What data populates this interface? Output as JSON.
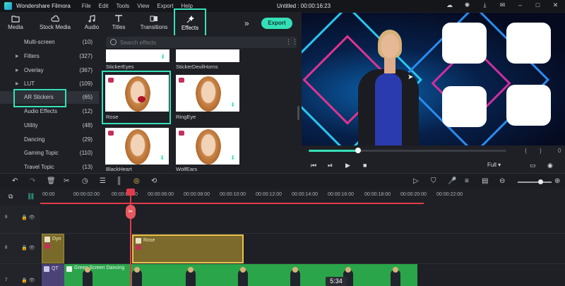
{
  "app": {
    "name": "Wondershare Filmora",
    "doc_title": "Untitled : 00:00:16:23"
  },
  "menu": [
    "File",
    "Edit",
    "Tools",
    "View",
    "Export",
    "Help"
  ],
  "tabs": [
    {
      "label": "Media",
      "icon": "folder-icon"
    },
    {
      "label": "Stock Media",
      "icon": "cloud-icon"
    },
    {
      "label": "Audio",
      "icon": "music-note-icon"
    },
    {
      "label": "Titles",
      "icon": "text-t-icon"
    },
    {
      "label": "Transitions",
      "icon": "transition-icon"
    },
    {
      "label": "Effects",
      "icon": "magic-wand-icon"
    }
  ],
  "export_label": "Export",
  "categories": [
    {
      "name": "Multi-screen",
      "count": "(10)"
    },
    {
      "name": "Filters",
      "count": "(327)"
    },
    {
      "name": "Overlay",
      "count": "(367)"
    },
    {
      "name": "LUT",
      "count": "(109)"
    },
    {
      "name": "AR Stickers",
      "count": "(65)"
    },
    {
      "name": "Audio Effects",
      "count": "(12)"
    },
    {
      "name": "Utility",
      "count": "(48)"
    },
    {
      "name": "Dancing",
      "count": "(29)"
    },
    {
      "name": "Gaming Topic",
      "count": "(110)"
    },
    {
      "name": "Travel Topic",
      "count": "(13)"
    }
  ],
  "search": {
    "placeholder": "Search effects"
  },
  "effects": [
    {
      "name": "StickerEyes"
    },
    {
      "name": "StickerDevilHorns"
    },
    {
      "name": "Rose"
    },
    {
      "name": "RingEye"
    },
    {
      "name": "BlackHeart"
    },
    {
      "name": "WolfEars"
    }
  ],
  "player": {
    "progress": 0.25,
    "quality": "Full"
  },
  "ruler": [
    "00:00",
    "00:00:02:00",
    "00:00:04:00",
    "00:00:06:00",
    "00:00:08:00",
    "00:00:10:00",
    "00:00:12:00",
    "00:00:14:00",
    "00:00:16:00",
    "00:00:18:00",
    "00:00:20:00",
    "00:00:22:00"
  ],
  "tracks": {
    "t9": {
      "label": "9"
    },
    "t8": {
      "label": "8"
    },
    "t7": {
      "label": "7"
    }
  },
  "clips": {
    "dyn": "Dyn",
    "rose": "Rose",
    "qt": "QT",
    "green": "Green Screen Dancing"
  },
  "duration_badge": "5:34",
  "colors": {
    "accent": "#35e0b8",
    "playhead": "#e23b4a",
    "effect_clip": "#7b6a2b",
    "video_clip": "#2aa54a"
  }
}
